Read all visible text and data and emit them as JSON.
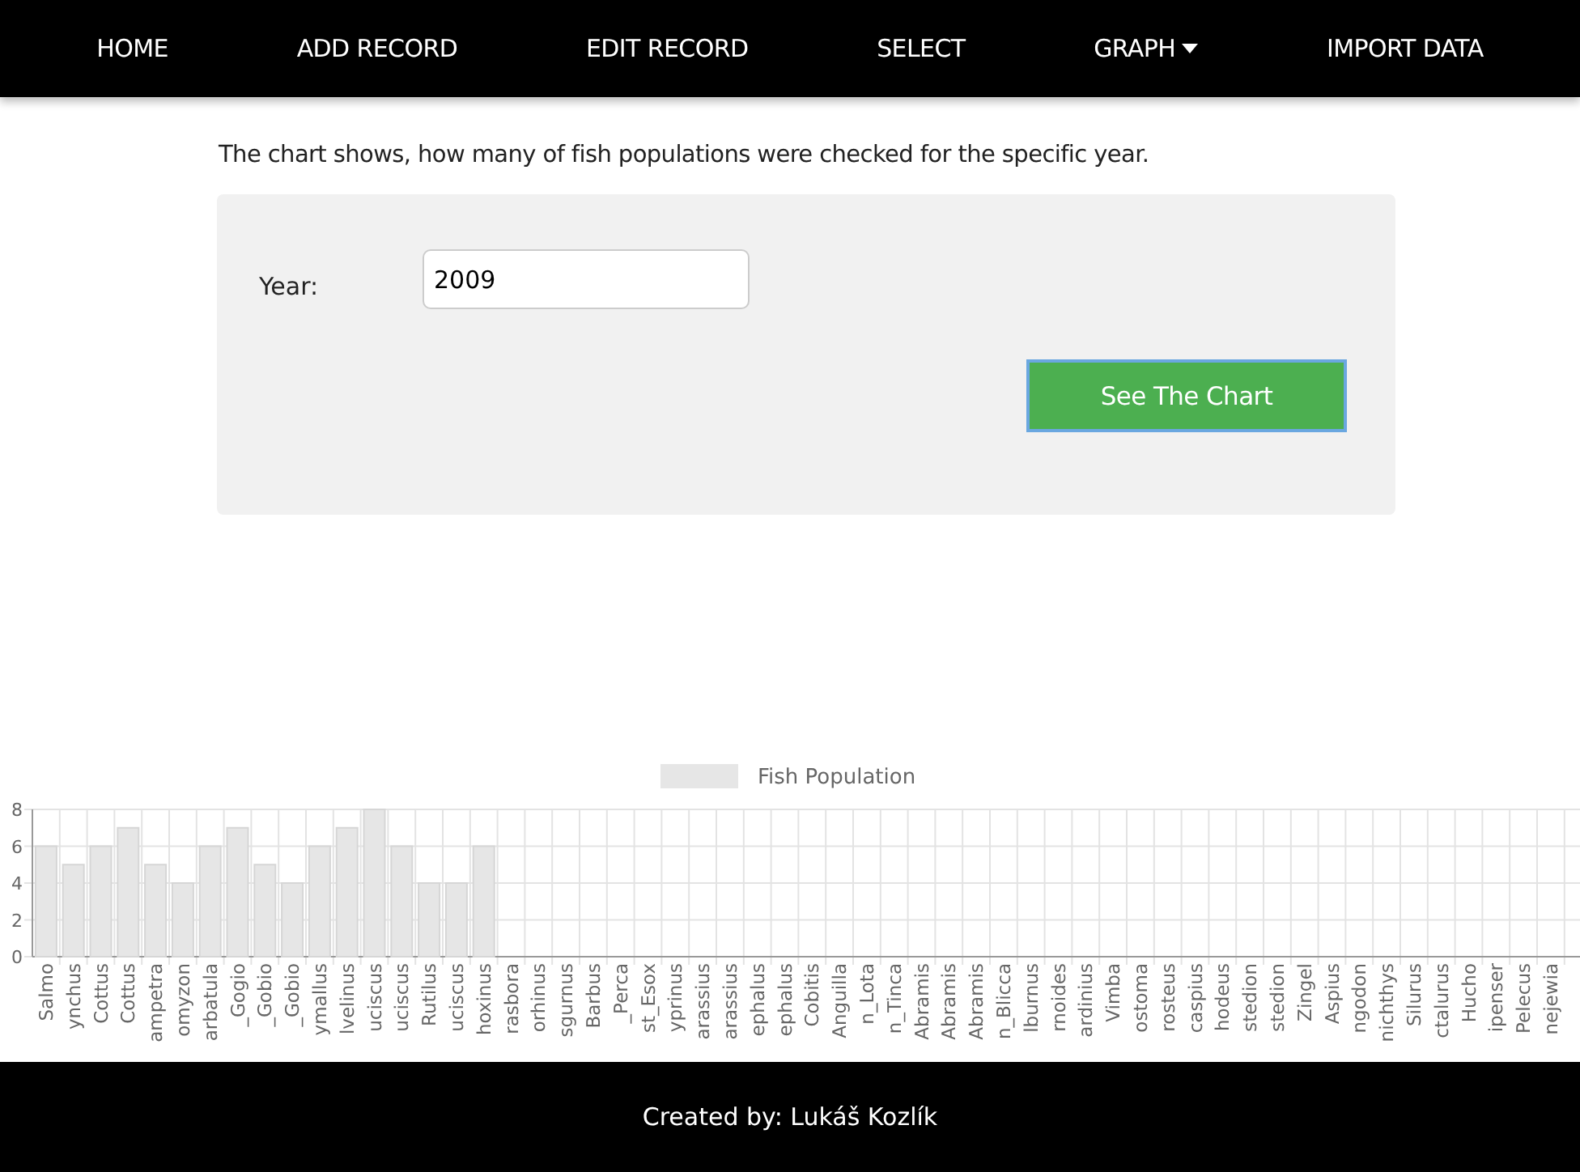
{
  "nav": [
    {
      "label": "HOME",
      "dropdown": false
    },
    {
      "label": "ADD RECORD",
      "dropdown": false
    },
    {
      "label": "EDIT RECORD",
      "dropdown": false
    },
    {
      "label": "SELECT",
      "dropdown": false
    },
    {
      "label": "GRAPH",
      "dropdown": true
    },
    {
      "label": "IMPORT DATA",
      "dropdown": false
    }
  ],
  "intro": "The chart shows, how many of fish populations were checked for the specific year.",
  "form": {
    "year_label": "Year:",
    "year_value": "2009",
    "button": "See The Chart"
  },
  "chart_data": {
    "type": "bar",
    "grid": true,
    "yticks": [
      0,
      2,
      4,
      6,
      8
    ],
    "ylim": [
      0,
      8
    ],
    "categories": [
      "Salmo",
      "ynchus",
      "Cottus",
      "Cottus",
      "ampetra",
      "omyzon",
      "arbatula",
      "_Gogio",
      "_Gobio",
      "_Gobio",
      "ymallus",
      "lvelinus",
      "uciscus",
      "uciscus",
      "Rutilus",
      "uciscus",
      "hoxinus",
      "rasbora",
      "orhinus",
      "sgurnus",
      "Barbus",
      "_Perca",
      "st_Esox",
      "yprinus",
      "arassius",
      "arassius",
      "ephalus",
      "ephalus",
      "Cobitis",
      "Anguilla",
      "n_Lota",
      "n_Tinca",
      "Abramis",
      "Abramis",
      "Abramis",
      "n_Blicca",
      "lburnus",
      "rnoides",
      "ardinius",
      "Vimba",
      "ostoma",
      "rosteus",
      "caspius",
      "hodeus",
      "stedion",
      "stedion",
      "Zingel",
      "Aspius",
      "ngodon",
      "nichthys",
      "Silurus",
      "ctalurus",
      "Hucho",
      "ipenser",
      "Pelecus",
      "nejewia"
    ],
    "series": [
      {
        "name": "Fish Population",
        "color": "#e6e6e6",
        "values": [
          6,
          5,
          6,
          7,
          5,
          4,
          6,
          7,
          5,
          4,
          6,
          7,
          8,
          6,
          4,
          4,
          6,
          0,
          0,
          0,
          0,
          0,
          0,
          0,
          0,
          0,
          0,
          0,
          0,
          0,
          0,
          0,
          0,
          0,
          0,
          0,
          0,
          0,
          0,
          0,
          0,
          0,
          0,
          0,
          0,
          0,
          0,
          0,
          0,
          0,
          0,
          0,
          0,
          0,
          0,
          0
        ]
      }
    ]
  },
  "footer": "Created by: Lukáš Kozlík"
}
